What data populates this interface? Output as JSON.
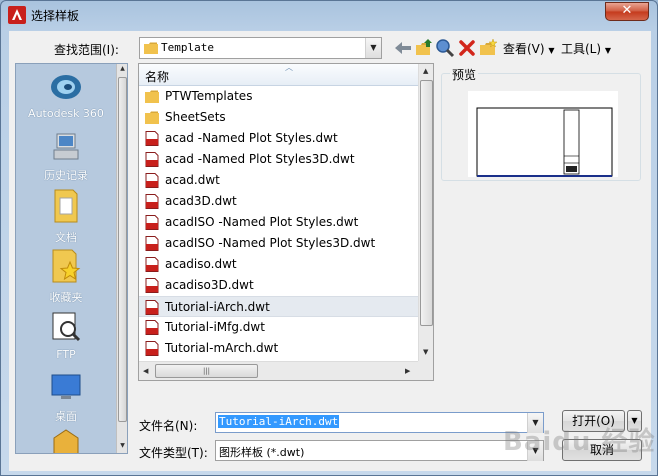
{
  "window": {
    "title": "选择样板",
    "close_glyph": "✕"
  },
  "lookin": {
    "label": "查找范围(I):",
    "value": "Template"
  },
  "toolbar": {
    "icons": [
      "back-icon",
      "up-folder-icon",
      "search-web-icon",
      "delete-icon",
      "new-folder-icon"
    ],
    "view_label": "查看(V)",
    "tools_label": "工具(L)"
  },
  "places": [
    {
      "label": "Autodesk 360",
      "icon": "autodesk-360-icon"
    },
    {
      "label": "历史记录",
      "icon": "history-icon"
    },
    {
      "label": "文档",
      "icon": "documents-icon"
    },
    {
      "label": "收藏夹",
      "icon": "favorites-icon"
    },
    {
      "label": "FTP",
      "icon": "ftp-icon"
    },
    {
      "label": "桌面",
      "icon": "desktop-icon"
    }
  ],
  "filelist": {
    "column_name": "名称",
    "items": [
      {
        "name": "PTWTemplates",
        "type": "folder"
      },
      {
        "name": "SheetSets",
        "type": "folder"
      },
      {
        "name": "acad -Named Plot Styles.dwt",
        "type": "dwt"
      },
      {
        "name": "acad -Named Plot Styles3D.dwt",
        "type": "dwt"
      },
      {
        "name": "acad.dwt",
        "type": "dwt"
      },
      {
        "name": "acad3D.dwt",
        "type": "dwt"
      },
      {
        "name": "acadISO -Named Plot Styles.dwt",
        "type": "dwt"
      },
      {
        "name": "acadISO -Named Plot Styles3D.dwt",
        "type": "dwt"
      },
      {
        "name": "acadiso.dwt",
        "type": "dwt"
      },
      {
        "name": "acadiso3D.dwt",
        "type": "dwt"
      },
      {
        "name": "Tutorial-iArch.dwt",
        "type": "dwt",
        "selected": true
      },
      {
        "name": "Tutorial-iMfg.dwt",
        "type": "dwt"
      },
      {
        "name": "Tutorial-mArch.dwt",
        "type": "dwt"
      }
    ]
  },
  "preview": {
    "label": "预览"
  },
  "filename": {
    "label": "文件名(N):",
    "value": "Tutorial-iArch.dwt"
  },
  "filetype": {
    "label": "文件类型(T):",
    "value": "图形样板 (*.dwt)"
  },
  "buttons": {
    "open": "打开(O)",
    "cancel": "取消"
  },
  "watermark": "Baidu 经验"
}
